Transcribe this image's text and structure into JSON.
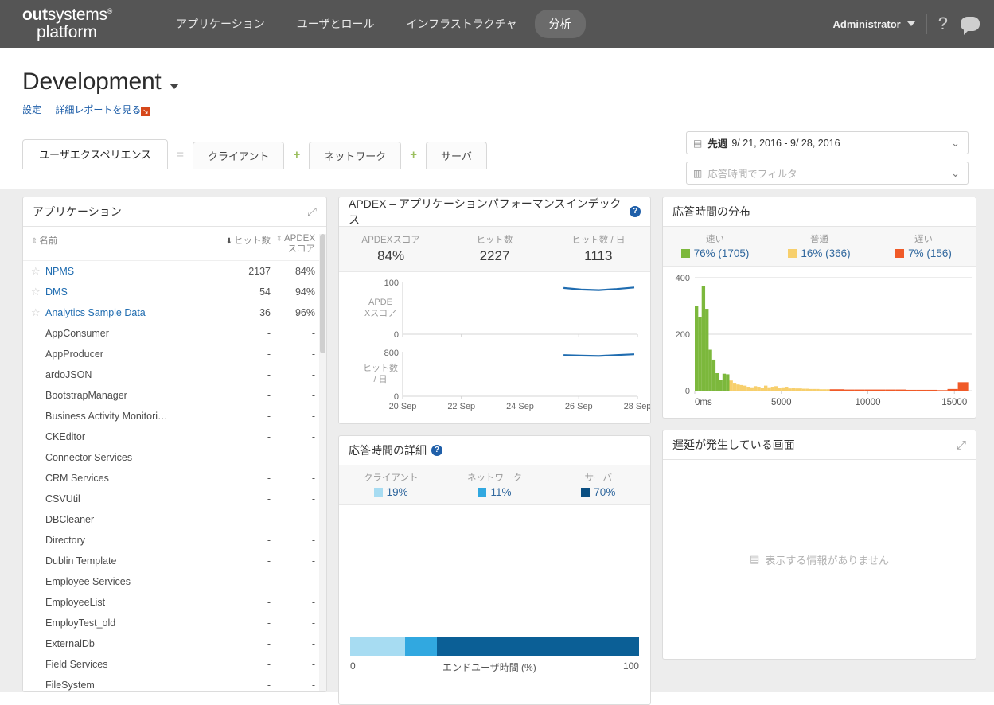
{
  "topnav": {
    "logo_line1_bold": "out",
    "logo_line1_rest": "systems",
    "logo_reg": "®",
    "logo_line2": "platform",
    "items": [
      {
        "label": "アプリケーション",
        "active": false
      },
      {
        "label": "ユーザとロール",
        "active": false
      },
      {
        "label": "インフラストラクチャ",
        "active": false
      },
      {
        "label": "分析",
        "active": true
      }
    ],
    "user": "Administrator",
    "help_icon": "question-mark-icon",
    "chat_icon": "chat-bubble-icon"
  },
  "page": {
    "title": "Development",
    "link_settings": "設定",
    "link_report": "詳細レポートを見る",
    "date_filter": {
      "icon": "calendar-icon",
      "label": "先週",
      "range": "9/ 21, 2016 - 9/ 28, 2016"
    },
    "response_filter": {
      "icon": "bar-chart-icon",
      "placeholder": "応答時間でフィルタ"
    }
  },
  "tabs": [
    {
      "label": "ユーザエクスペリエンス",
      "active": true
    },
    {
      "sep": "="
    },
    {
      "label": "クライアント",
      "active": false
    },
    {
      "sep": "+"
    },
    {
      "label": "ネットワーク",
      "active": false
    },
    {
      "sep": "+"
    },
    {
      "label": "サーバ",
      "active": false
    }
  ],
  "applications": {
    "title": "アプリケーション",
    "expand_icon": "expand-icon",
    "columns": {
      "name": "名前",
      "hits": "ヒット数",
      "apdex_line1": "APDEX",
      "apdex_line2": "スコア"
    },
    "rows": [
      {
        "star": true,
        "name": "NPMS",
        "link": true,
        "hits": "2137",
        "apdex": "84%"
      },
      {
        "star": true,
        "name": "DMS",
        "link": true,
        "hits": "54",
        "apdex": "94%"
      },
      {
        "star": true,
        "name": "Analytics Sample Data",
        "link": true,
        "hits": "36",
        "apdex": "96%"
      },
      {
        "star": false,
        "name": "AppConsumer",
        "link": false,
        "hits": "-",
        "apdex": "-"
      },
      {
        "star": false,
        "name": "AppProducer",
        "link": false,
        "hits": "-",
        "apdex": "-"
      },
      {
        "star": false,
        "name": "ardoJSON",
        "link": false,
        "hits": "-",
        "apdex": "-"
      },
      {
        "star": false,
        "name": "BootstrapManager",
        "link": false,
        "hits": "-",
        "apdex": "-"
      },
      {
        "star": false,
        "name": "Business Activity Monitori…",
        "link": false,
        "hits": "-",
        "apdex": "-"
      },
      {
        "star": false,
        "name": "CKEditor",
        "link": false,
        "hits": "-",
        "apdex": "-"
      },
      {
        "star": false,
        "name": "Connector Services",
        "link": false,
        "hits": "-",
        "apdex": "-"
      },
      {
        "star": false,
        "name": "CRM Services",
        "link": false,
        "hits": "-",
        "apdex": "-"
      },
      {
        "star": false,
        "name": "CSVUtil",
        "link": false,
        "hits": "-",
        "apdex": "-"
      },
      {
        "star": false,
        "name": "DBCleaner",
        "link": false,
        "hits": "-",
        "apdex": "-"
      },
      {
        "star": false,
        "name": "Directory",
        "link": false,
        "hits": "-",
        "apdex": "-"
      },
      {
        "star": false,
        "name": "Dublin Template",
        "link": false,
        "hits": "-",
        "apdex": "-"
      },
      {
        "star": false,
        "name": "Employee Services",
        "link": false,
        "hits": "-",
        "apdex": "-"
      },
      {
        "star": false,
        "name": "EmployeeList",
        "link": false,
        "hits": "-",
        "apdex": "-"
      },
      {
        "star": false,
        "name": "EmployTest_old",
        "link": false,
        "hits": "-",
        "apdex": "-"
      },
      {
        "star": false,
        "name": "ExternalDb",
        "link": false,
        "hits": "-",
        "apdex": "-"
      },
      {
        "star": false,
        "name": "Field Services",
        "link": false,
        "hits": "-",
        "apdex": "-"
      },
      {
        "star": false,
        "name": "FileSystem",
        "link": false,
        "hits": "-",
        "apdex": "-"
      }
    ]
  },
  "apdex_panel": {
    "title": "APDEX – アプリケーションパフォーマンスインデックス",
    "help_icon": "help-icon",
    "stats": [
      {
        "label": "APDEXスコア",
        "value": "84%"
      },
      {
        "label": "ヒット数",
        "value": "2227"
      },
      {
        "label": "ヒット数 / 日",
        "value": "1113"
      }
    ]
  },
  "distribution_panel": {
    "title": "応答時間の分布",
    "legend": [
      {
        "label": "速い",
        "value": "76% (1705)",
        "color": "#7cb83c"
      },
      {
        "label": "普通",
        "value": "16% (366)",
        "color": "#f7cf6c"
      },
      {
        "label": "遅い",
        "value": "7% (156)",
        "color": "#f05a28"
      }
    ]
  },
  "detail_panel": {
    "title": "応答時間の詳細",
    "help_icon": "help-icon",
    "legend": [
      {
        "label": "クライアント",
        "value": "19%",
        "color": "#a7dcf2"
      },
      {
        "label": "ネットワーク",
        "value": "11%",
        "color": "#31a8e0"
      },
      {
        "label": "サーバ",
        "value": "70%",
        "color": "#0b4f82"
      }
    ]
  },
  "slow_panel": {
    "title": "遅延が発生している画面",
    "expand_icon": "expand-icon",
    "empty_text": "表示する情報がありません",
    "empty_icon": "no-data-icon"
  },
  "chart_data": [
    {
      "type": "line",
      "title": "APDEXスコア",
      "ylabel": "APDEXスコア",
      "xlabel": "",
      "ylim": [
        0,
        100
      ],
      "yticks": [
        0,
        100
      ],
      "xticks": [
        "20 Sep",
        "22 Sep",
        "24 Sep",
        "26 Sep",
        "28 Sep"
      ],
      "grid": false,
      "series": [
        {
          "name": "APDEX",
          "color": "#1f6cb0",
          "x": [
            "26 Sep",
            "26.5 Sep",
            "27 Sep",
            "27.5 Sep",
            "28 Sep"
          ],
          "values": [
            88,
            85,
            84,
            86,
            89
          ]
        }
      ]
    },
    {
      "type": "line",
      "title": "ヒット数 / 日",
      "ylabel": "ヒット数 / 日",
      "xlabel": "",
      "ylim": [
        0,
        800
      ],
      "yticks": [
        0,
        800
      ],
      "xticks": [
        "20 Sep",
        "22 Sep",
        "24 Sep",
        "26 Sep",
        "28 Sep"
      ],
      "grid": false,
      "series": [
        {
          "name": "ヒット数/日",
          "color": "#1f6cb0",
          "x": [
            "26 Sep",
            "26.5 Sep",
            "27 Sep",
            "27.5 Sep",
            "28 Sep"
          ],
          "values": [
            740,
            730,
            725,
            740,
            755
          ]
        }
      ]
    },
    {
      "type": "bar",
      "title": "応答時間の分布",
      "xlabel": "",
      "ylabel": "",
      "ylim": [
        0,
        400
      ],
      "yticks": [
        0,
        200,
        400
      ],
      "xticks": [
        "0ms",
        "5000",
        "10000",
        "15000"
      ],
      "xlim": [
        0,
        16000
      ],
      "bin_width_ms": 200,
      "grid": true,
      "categories": [
        0,
        200,
        400,
        600,
        800,
        1000,
        1200,
        1400,
        1600,
        1800,
        2000,
        2200,
        2400,
        2600,
        2800,
        3000,
        3200,
        3400,
        3600,
        3800,
        4000,
        4200,
        4400,
        4600,
        4800,
        5000,
        5200,
        5400,
        5600,
        5800,
        6000,
        6200,
        6400,
        6600,
        6800,
        7000,
        7200,
        7400,
        7600,
        7800,
        8000,
        8600,
        9200,
        9800,
        10400,
        11000,
        11600,
        12200,
        12800,
        13400,
        14000,
        14600,
        15200
      ],
      "values": [
        300,
        260,
        370,
        290,
        145,
        110,
        62,
        38,
        60,
        58,
        36,
        28,
        22,
        20,
        18,
        14,
        12,
        16,
        14,
        10,
        18,
        12,
        14,
        16,
        10,
        12,
        14,
        8,
        10,
        8,
        8,
        7,
        7,
        6,
        6,
        6,
        5,
        5,
        5,
        5,
        5,
        4,
        4,
        4,
        4,
        4,
        4,
        3,
        3,
        3,
        2,
        6,
        30
      ],
      "colors": [
        "#7cb83c",
        "#7cb83c",
        "#7cb83c",
        "#7cb83c",
        "#7cb83c",
        "#7cb83c",
        "#7cb83c",
        "#7cb83c",
        "#7cb83c",
        "#7cb83c",
        "#f7cf6c",
        "#f7cf6c",
        "#f7cf6c",
        "#f7cf6c",
        "#f7cf6c",
        "#f7cf6c",
        "#f7cf6c",
        "#f7cf6c",
        "#f7cf6c",
        "#f7cf6c",
        "#f7cf6c",
        "#f7cf6c",
        "#f7cf6c",
        "#f7cf6c",
        "#f7cf6c",
        "#f7cf6c",
        "#f7cf6c",
        "#f7cf6c",
        "#f7cf6c",
        "#f7cf6c",
        "#f7cf6c",
        "#f7cf6c",
        "#f7cf6c",
        "#f7cf6c",
        "#f7cf6c",
        "#f7cf6c",
        "#f7cf6c",
        "#f7cf6c",
        "#f7cf6c",
        "#f05a28",
        "#f05a28",
        "#f05a28",
        "#f05a28",
        "#f05a28",
        "#f05a28",
        "#f05a28",
        "#f05a28",
        "#f05a28",
        "#f05a28",
        "#f05a28",
        "#f05a28",
        "#f05a28",
        "#f05a28"
      ]
    },
    {
      "type": "bar",
      "title": "応答時間の詳細",
      "orientation": "horizontal-stacked",
      "xlabel": "エンドユーザ時間 (%)",
      "axis_min": "0",
      "axis_max": "100",
      "categories": [
        "クライアント",
        "ネットワーク",
        "サーバ"
      ],
      "values": [
        19,
        11,
        70
      ],
      "colors": [
        "#a7dcf2",
        "#31a8e0",
        "#0b5f96"
      ]
    }
  ]
}
